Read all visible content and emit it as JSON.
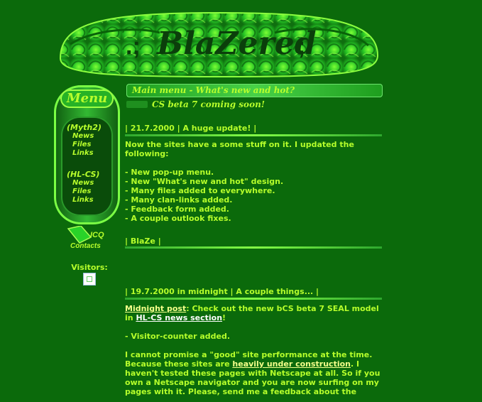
{
  "banner": {
    "title": "BlaZered",
    "left_mark": ".;",
    "right_mark": ";."
  },
  "menu": {
    "title": "Menu",
    "groups": [
      {
        "title": "(Myth2)",
        "items": [
          "News",
          "Files",
          "Links"
        ]
      },
      {
        "title": "(HL-CS)",
        "items": [
          "News",
          "Files",
          "Links"
        ]
      }
    ]
  },
  "side": {
    "icq_label": "ICQ",
    "icq_sub": "Contacts",
    "visitors_label": "Visitors:"
  },
  "main": {
    "header": "Main menu - What's new and hot?",
    "news_ticker": "CS beta 7 coming soon!",
    "post1": {
      "title": "| 21.7.2000 | A huge update! |",
      "intro": "Now the sites have a some stuff on it. I updated the following:",
      "items": [
        "- New pop-up menu.",
        "- New \"What's new and hot\" design.",
        "- Many files added to everywhere.",
        "- Many clan-links added.",
        "- Feedback form added.",
        "- A couple outlook fixes."
      ],
      "signature": "| BlaZe |"
    },
    "post2": {
      "title": "| 19.7.2000 in midnight | A couple things... |",
      "midnight_link": "Midnight post",
      "text_a": ": Check out the new bCS beta 7 SEAL model in ",
      "news_link": "HL-CS news section",
      "text_b": "!",
      "visitor_counter": "- Visitor-counter added.",
      "para_a": "I cannot promise a \"good\" site performance  at the time. Because these sites are ",
      "construction_link": "heavily under construction",
      "para_b": ". I haven't tested these pages with Netscape at all. So if you own a Netscape navigator and you are now surfing on my pages with it. Please, send me a feedback about the"
    }
  }
}
